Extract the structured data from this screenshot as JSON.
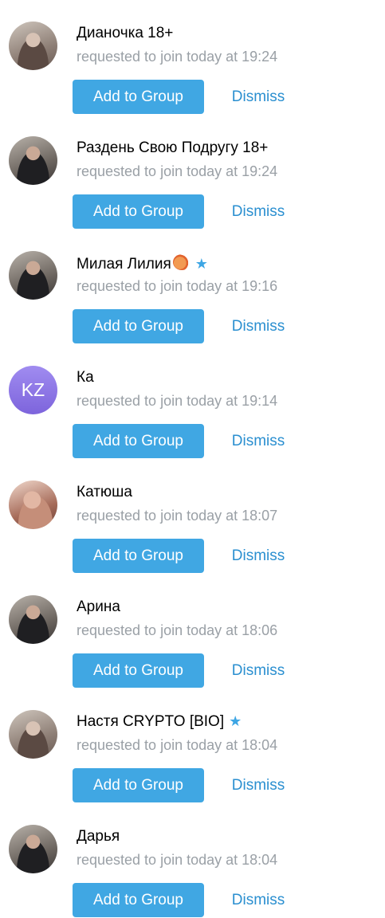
{
  "requests": [
    {
      "name": "Дианочка 18+",
      "status": "requested to join today at 19:24",
      "add_label": "Add to Group",
      "dismiss_label": "Dismiss",
      "avatar": "photo",
      "verified": false,
      "emoji": false
    },
    {
      "name": "Раздень Свою Подругу 18+",
      "status": "requested to join today at 19:24",
      "add_label": "Add to Group",
      "dismiss_label": "Dismiss",
      "avatar": "photo-dark",
      "verified": false,
      "emoji": false
    },
    {
      "name": "Милая Лилия",
      "status": "requested to join today at 19:16",
      "add_label": "Add to Group",
      "dismiss_label": "Dismiss",
      "avatar": "photo-dark",
      "verified": true,
      "emoji": true
    },
    {
      "name": "Ка",
      "status": "requested to join today at 19:14",
      "add_label": "Add to Group",
      "dismiss_label": "Dismiss",
      "avatar": "initials",
      "initials": "KZ",
      "verified": false,
      "emoji": false
    },
    {
      "name": "Катюша",
      "status": "requested to join today at 18:07",
      "add_label": "Add to Group",
      "dismiss_label": "Dismiss",
      "avatar": "photo-warm",
      "verified": false,
      "emoji": false
    },
    {
      "name": "Арина",
      "status": "requested to join today at 18:06",
      "add_label": "Add to Group",
      "dismiss_label": "Dismiss",
      "avatar": "photo-dark",
      "verified": false,
      "emoji": false
    },
    {
      "name": "Настя CRYPTO [BIO]",
      "status": "requested to join today at 18:04",
      "add_label": "Add to Group",
      "dismiss_label": "Dismiss",
      "avatar": "photo",
      "verified": true,
      "emoji": false
    },
    {
      "name": "Дарья",
      "status": "requested to join today at 18:04",
      "add_label": "Add to Group",
      "dismiss_label": "Dismiss",
      "avatar": "photo-dark",
      "verified": false,
      "emoji": false
    }
  ],
  "colors": {
    "accent": "#40a7e3",
    "link": "#2a8fd0",
    "muted_text": "#9aa0a6",
    "initials_avatar": "#8b74e6",
    "verified_star": "#3ea6e4"
  },
  "icons": {
    "verified": "star-icon",
    "emoji": "peach-emoji-icon"
  }
}
